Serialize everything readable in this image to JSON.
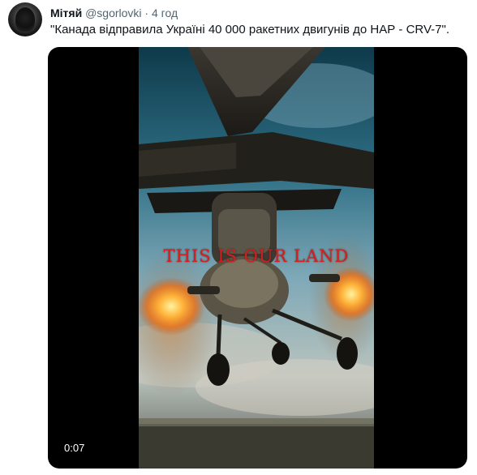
{
  "tweet": {
    "author_name": "Мітяй",
    "handle": "@sgorlovki",
    "separator": "·",
    "time": "4 год",
    "text": "\"Канада відправила Україні 40 000 ракетних двигунів до НАР - CRV-7\"."
  },
  "media": {
    "overlay_caption": "THIS IS OUR LAND",
    "timestamp": "0:07"
  },
  "colors": {
    "name_text": "#0f1419",
    "secondary_text": "#536471",
    "overlay_caption": "#d21f1f",
    "media_background": "#000000"
  }
}
